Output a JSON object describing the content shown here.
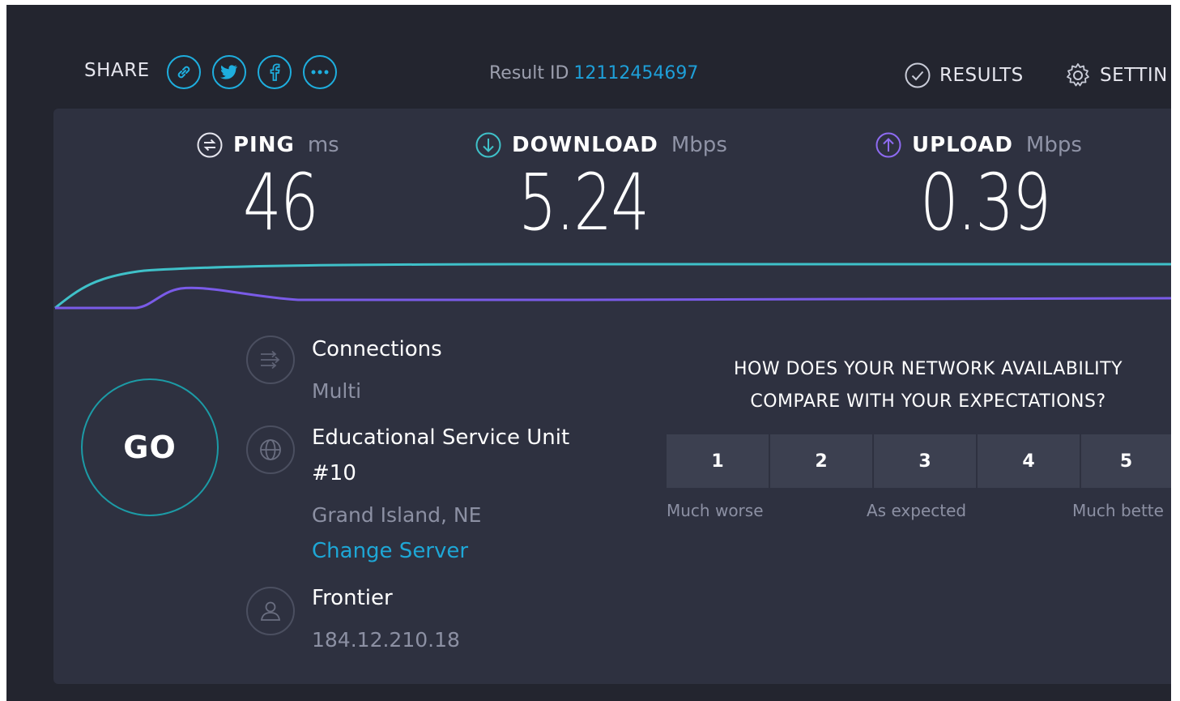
{
  "header": {
    "share_label": "SHARE",
    "share_buttons": [
      "link-icon",
      "twitter-icon",
      "facebook-icon",
      "more-icon"
    ],
    "result_id_label": "Result ID",
    "result_id_value": "12112454697",
    "results_label": "RESULTS",
    "settings_label": "SETTIN"
  },
  "metrics": {
    "ping": {
      "label": "PING",
      "unit": "ms",
      "value": "46"
    },
    "download": {
      "label": "DOWNLOAD",
      "unit": "Mbps",
      "value": "5.24"
    },
    "upload": {
      "label": "UPLOAD",
      "unit": "Mbps",
      "value": "0.39"
    }
  },
  "go_label": "GO",
  "connections": {
    "title": "Connections",
    "value": "Multi"
  },
  "server": {
    "name_line1": "Educational Service Unit",
    "name_line2": "#10",
    "location": "Grand Island, NE",
    "change_label": "Change Server"
  },
  "isp": {
    "name": "Frontier",
    "ip": "184.12.210.18"
  },
  "survey": {
    "question_line1": "HOW DOES YOUR NETWORK AVAILABILITY",
    "question_line2": "COMPARE WITH YOUR EXPECTATIONS?",
    "ratings": [
      "1",
      "2",
      "3",
      "4",
      "5"
    ],
    "label_low": "Much worse",
    "label_mid": "As expected",
    "label_high": "Much bette"
  },
  "colors": {
    "accent": "#1eaede",
    "download": "#3fc1c9",
    "upload": "#8e6bf2",
    "background": "#23252f",
    "panel": "#2e3140"
  }
}
